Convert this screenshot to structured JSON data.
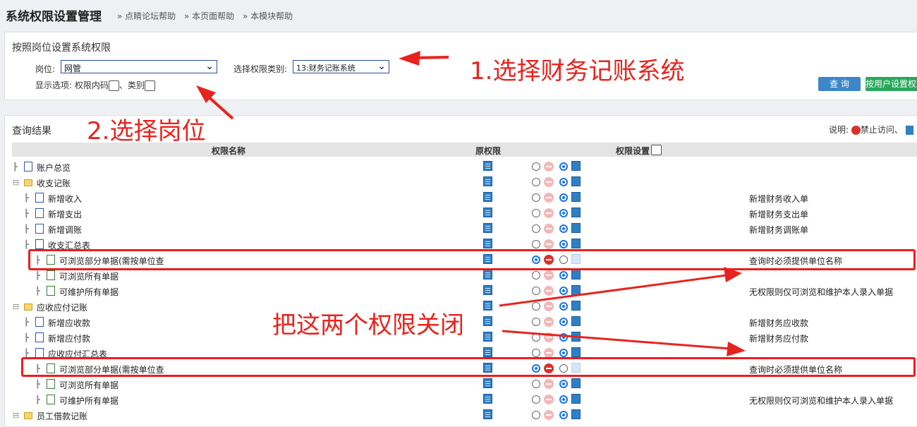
{
  "header": {
    "title": "系统权限设置管理",
    "links": [
      "» 点睛论坛帮助",
      "» 本页面帮助",
      "» 本模块帮助"
    ]
  },
  "filter": {
    "section_title": "按照岗位设置系统权限",
    "position_label": "岗位:",
    "position_value": "网管",
    "category_label": "选择权限类别:",
    "category_value": "13:财务记账系统",
    "display_label": "显示选项:",
    "opt_code": "权限内码",
    "opt_sep": "、类别",
    "query_button": "查 询",
    "user_button": "按用户设置权限"
  },
  "results": {
    "section_title": "查询结果",
    "legend_label": "说明:",
    "legend_deny": "禁止访问、",
    "col_name": "权限名称",
    "col_orig": "原权限",
    "col_set": "权限设置",
    "rows": [
      {
        "name": "账户总览",
        "level": 0,
        "icon": "doc",
        "mode": "allow",
        "desc": ""
      },
      {
        "name": "收支记账",
        "level": 0,
        "icon": "folder",
        "mode": "allow",
        "desc": ""
      },
      {
        "name": "新增收入",
        "level": 1,
        "icon": "doc",
        "mode": "allow",
        "desc": "新增财务收入单"
      },
      {
        "name": "新增支出",
        "level": 1,
        "icon": "doc",
        "mode": "allow",
        "desc": "新增财务支出单"
      },
      {
        "name": "新增调账",
        "level": 1,
        "icon": "doc",
        "mode": "allow",
        "desc": "新增财务调账单"
      },
      {
        "name": "收支汇总表",
        "level": 1,
        "icon": "doc",
        "mode": "allow",
        "desc": ""
      },
      {
        "name": "可浏览部分单据(需按单位查",
        "level": 2,
        "icon": "grid",
        "mode": "deny",
        "desc": "查询时必须提供单位名称"
      },
      {
        "name": "可浏览所有单据",
        "level": 2,
        "icon": "grid",
        "mode": "allow",
        "desc": ""
      },
      {
        "name": "可维护所有单据",
        "level": 2,
        "icon": "grid",
        "mode": "allow",
        "desc": "无权限则仅可浏览和维护本人录入单据"
      },
      {
        "name": "应收应付记账",
        "level": 0,
        "icon": "folder",
        "mode": "allow",
        "desc": ""
      },
      {
        "name": "新增应收款",
        "level": 1,
        "icon": "doc",
        "mode": "allow",
        "desc": "新增财务应收款"
      },
      {
        "name": "新增应付款",
        "level": 1,
        "icon": "doc",
        "mode": "allow",
        "desc": "新增财务应付款"
      },
      {
        "name": "应收应付汇总表",
        "level": 1,
        "icon": "doc",
        "mode": "allow",
        "desc": ""
      },
      {
        "name": "可浏览部分单据(需按单位查",
        "level": 2,
        "icon": "grid",
        "mode": "deny",
        "desc": "查询时必须提供单位名称"
      },
      {
        "name": "可浏览所有单据",
        "level": 2,
        "icon": "grid",
        "mode": "allow",
        "desc": ""
      },
      {
        "name": "可维护所有单据",
        "level": 2,
        "icon": "grid",
        "mode": "allow",
        "desc": "无权限则仅可浏览和维护本人录入单据"
      },
      {
        "name": "员工借款记账",
        "level": 0,
        "icon": "folder",
        "mode": "allow",
        "desc": ""
      }
    ]
  },
  "annotations": {
    "step1": "1.选择财务记账系统",
    "step2": "2.选择岗位",
    "close_note": "把这两个权限关闭"
  },
  "colors": {
    "accent_red": "#e8231e",
    "query_blue": "#3c86c9",
    "user_green": "#27a85a"
  }
}
